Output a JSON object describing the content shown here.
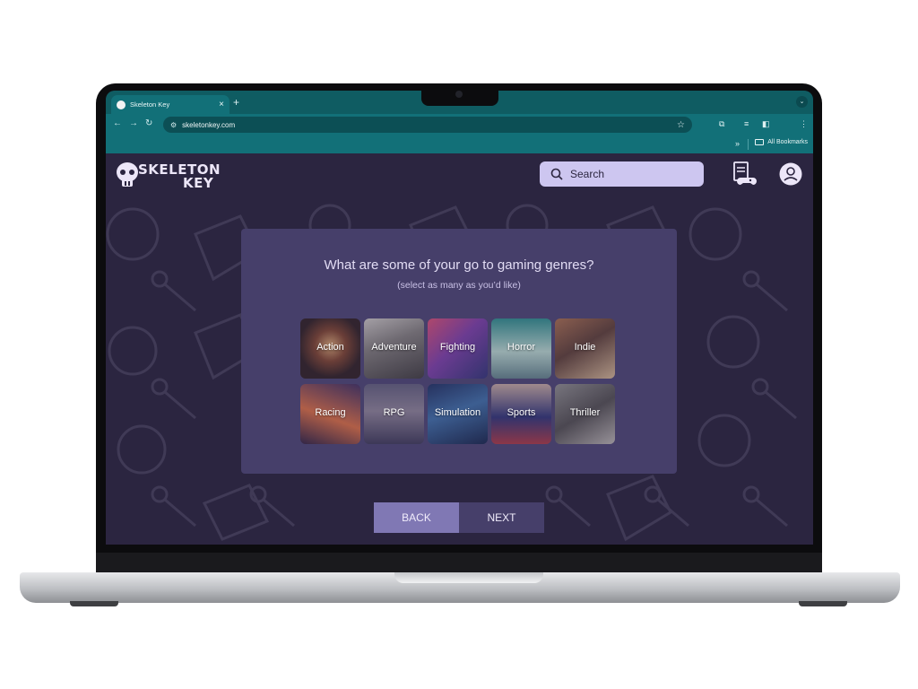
{
  "browser": {
    "tab_title": "Skeleton Key",
    "tab_close": "×",
    "new_tab": "+",
    "url": "skeletonkey.com",
    "bookmarks_label": "All Bookmarks",
    "bookmarks_chevron": "»",
    "theme_color": "#127078"
  },
  "site": {
    "logo": {
      "line1": "SKELETON",
      "line2": "KEY"
    },
    "search": {
      "placeholder": "Search"
    },
    "icons": [
      "gamepad-document-icon",
      "account-icon"
    ]
  },
  "onboarding": {
    "question": "What are some of your go to gaming genres?",
    "hint": "(select as many as you’d like)",
    "genres": [
      {
        "label": "Action",
        "bg": "radial-gradient(circle at 50% 45%, #d9a36a 0%, #7a3e24 35%, #2a1a18 70%)"
      },
      {
        "label": "Adventure",
        "bg": "linear-gradient(160deg, #c9c4bc 0%, #7f7a74 40%, #3b3734 100%)"
      },
      {
        "label": "Fighting",
        "bg": "linear-gradient(135deg, #d74a6c 0%, #7a3aa0 45%, #2c2f6e 100%)"
      },
      {
        "label": "Horror",
        "bg": "linear-gradient(180deg, #2a8a84 0%, #b7d6c8 55%, #5e7f82 100%)"
      },
      {
        "label": "Indie",
        "bg": "linear-gradient(150deg, #a66a45 0%, #5a3a2c 45%, #d4b48c 100%)"
      },
      {
        "label": "Racing",
        "bg": "linear-gradient(200deg, #3b2a58 0%, #d96a3a 55%, #2a1c3a 100%)"
      },
      {
        "label": "RPG",
        "bg": "linear-gradient(180deg, #5e5a74 0%, #8a7f8f 45%, #3a3550 100%)"
      },
      {
        "label": "Simulation",
        "bg": "linear-gradient(160deg, #1b2c5a 0%, #3a6aa0 45%, #122042 100%)"
      },
      {
        "label": "Sports",
        "bg": "linear-gradient(180deg, #c4a79a 0%, #2b2f6e 55%, #a8343b 100%)"
      },
      {
        "label": "Thriller",
        "bg": "linear-gradient(150deg, #8c8a86 0%, #4e4a47 50%, #b7b1aa 100%)"
      }
    ],
    "back_label": "BACK",
    "next_label": "NEXT"
  },
  "colors": {
    "page_bg": "#2b2540",
    "card_bg": "#463f6a",
    "search_bg": "#cdc6f0",
    "back_bg": "#8078b4"
  }
}
